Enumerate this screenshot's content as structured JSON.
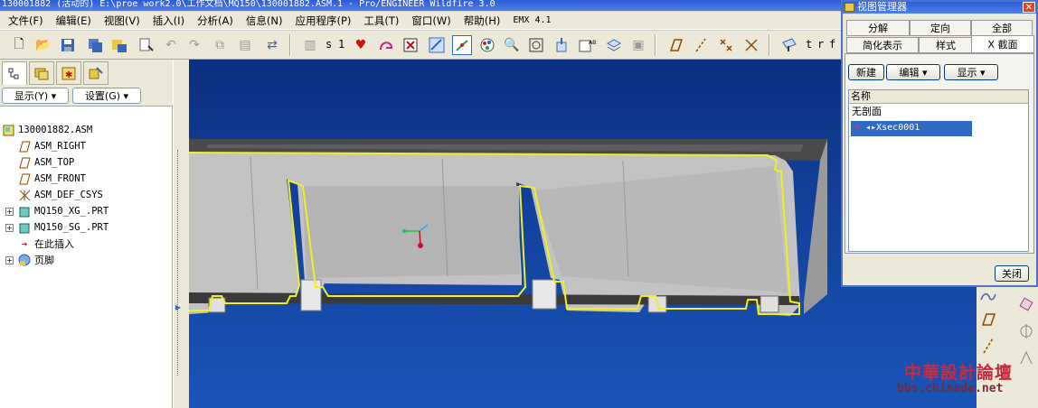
{
  "window": {
    "title": "130001882 (活动的) E:\\proe work2.0\\工作文档\\MQ150\\130001882.ASM.1 - Pro/ENGINEER Wildfire 3.0"
  },
  "menu": [
    "文件(F)",
    "编辑(E)",
    "视图(V)",
    "插入(I)",
    "分析(A)",
    "信息(N)",
    "应用程序(P)",
    "工具(T)",
    "窗口(W)",
    "帮助(H)",
    "EMX 4.1"
  ],
  "toolbar": {
    "text_s": "s",
    "text_1": "1",
    "text_t": "t",
    "text_r": "r",
    "text_f": "f"
  },
  "left_panel": {
    "show_label": "显示(Y) ▾",
    "settings_label": "设置(G) ▾",
    "tree": [
      {
        "label": "130001882.ASM",
        "icon": "assembly-icon"
      },
      {
        "label": "ASM_RIGHT",
        "icon": "datum-plane-icon"
      },
      {
        "label": "ASM_TOP",
        "icon": "datum-plane-icon"
      },
      {
        "label": "ASM_FRONT",
        "icon": "datum-plane-icon"
      },
      {
        "label": "ASM_DEF_CSYS",
        "icon": "csys-icon"
      },
      {
        "label": "MQ150_XG_.PRT",
        "icon": "part-icon"
      },
      {
        "label": "MQ150_SG_.PRT",
        "icon": "part-icon"
      },
      {
        "label": "在此插入",
        "icon": "insert-here-icon"
      },
      {
        "label": "页脚",
        "icon": "footer-icon"
      }
    ]
  },
  "view_manager": {
    "title": "视图管理器",
    "tabs_row1": [
      "分解",
      "定向",
      "全部"
    ],
    "tabs_row2": [
      "简化表示",
      "样式",
      "X 截面"
    ],
    "new_label": "新建",
    "edit_label": "编辑 ▾",
    "display_label": "显示 ▾",
    "list_header": "名称",
    "items": [
      "无剖面",
      "Xsec0001"
    ],
    "selected_marker": "◂▸",
    "close_label": "关闭"
  },
  "watermark": {
    "line1": "中華設計論壇",
    "line2": "bbs.chinade.net"
  },
  "colors": {
    "viewport_bg": "#123f9a",
    "model_gray": "#c3c3c3",
    "section_edge": "#f0f020",
    "selection": "#316ac5"
  }
}
